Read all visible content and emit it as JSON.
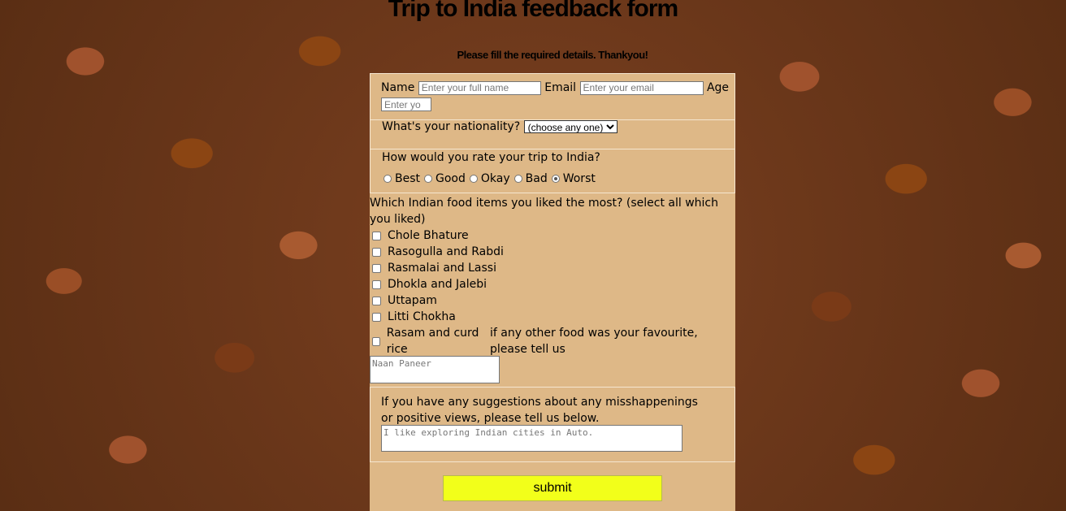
{
  "page": {
    "title": "Trip to India feedback form",
    "subtitle": "Please fill the required details. Thankyou!"
  },
  "details": {
    "name_label": "Name",
    "name_placeholder": "Enter your full name",
    "email_label": "Email",
    "email_placeholder": "Enter your email",
    "age_label": "Age",
    "age_placeholder": "Enter yo"
  },
  "nationality": {
    "question": "What's your nationality?",
    "selected": "(choose any one)"
  },
  "rating": {
    "question": "How would you rate your trip to India?",
    "options": [
      "Best",
      "Good",
      "Okay",
      "Bad",
      "Worst"
    ],
    "selected": "Worst"
  },
  "food": {
    "question": "Which Indian food items you liked the most? (select all which you liked)",
    "items": [
      "Chole Bhature",
      "Rasogulla and Rabdi",
      "Rasmalai and Lassi",
      "Dhokla and Jalebi",
      "Uttapam",
      "Litti Chokha",
      "Rasam and curd rice"
    ],
    "other_prompt": "if any other food was your favourite, please tell us",
    "other_placeholder": "Naan Paneer"
  },
  "suggestions": {
    "question": "If you have any suggestions about any misshappenings or positive views, please tell us below.",
    "placeholder": "I like exploring Indian cities in Auto."
  },
  "submit_label": "submit",
  "colors": {
    "panel": "#deb887",
    "submit": "#f2ff1a"
  }
}
